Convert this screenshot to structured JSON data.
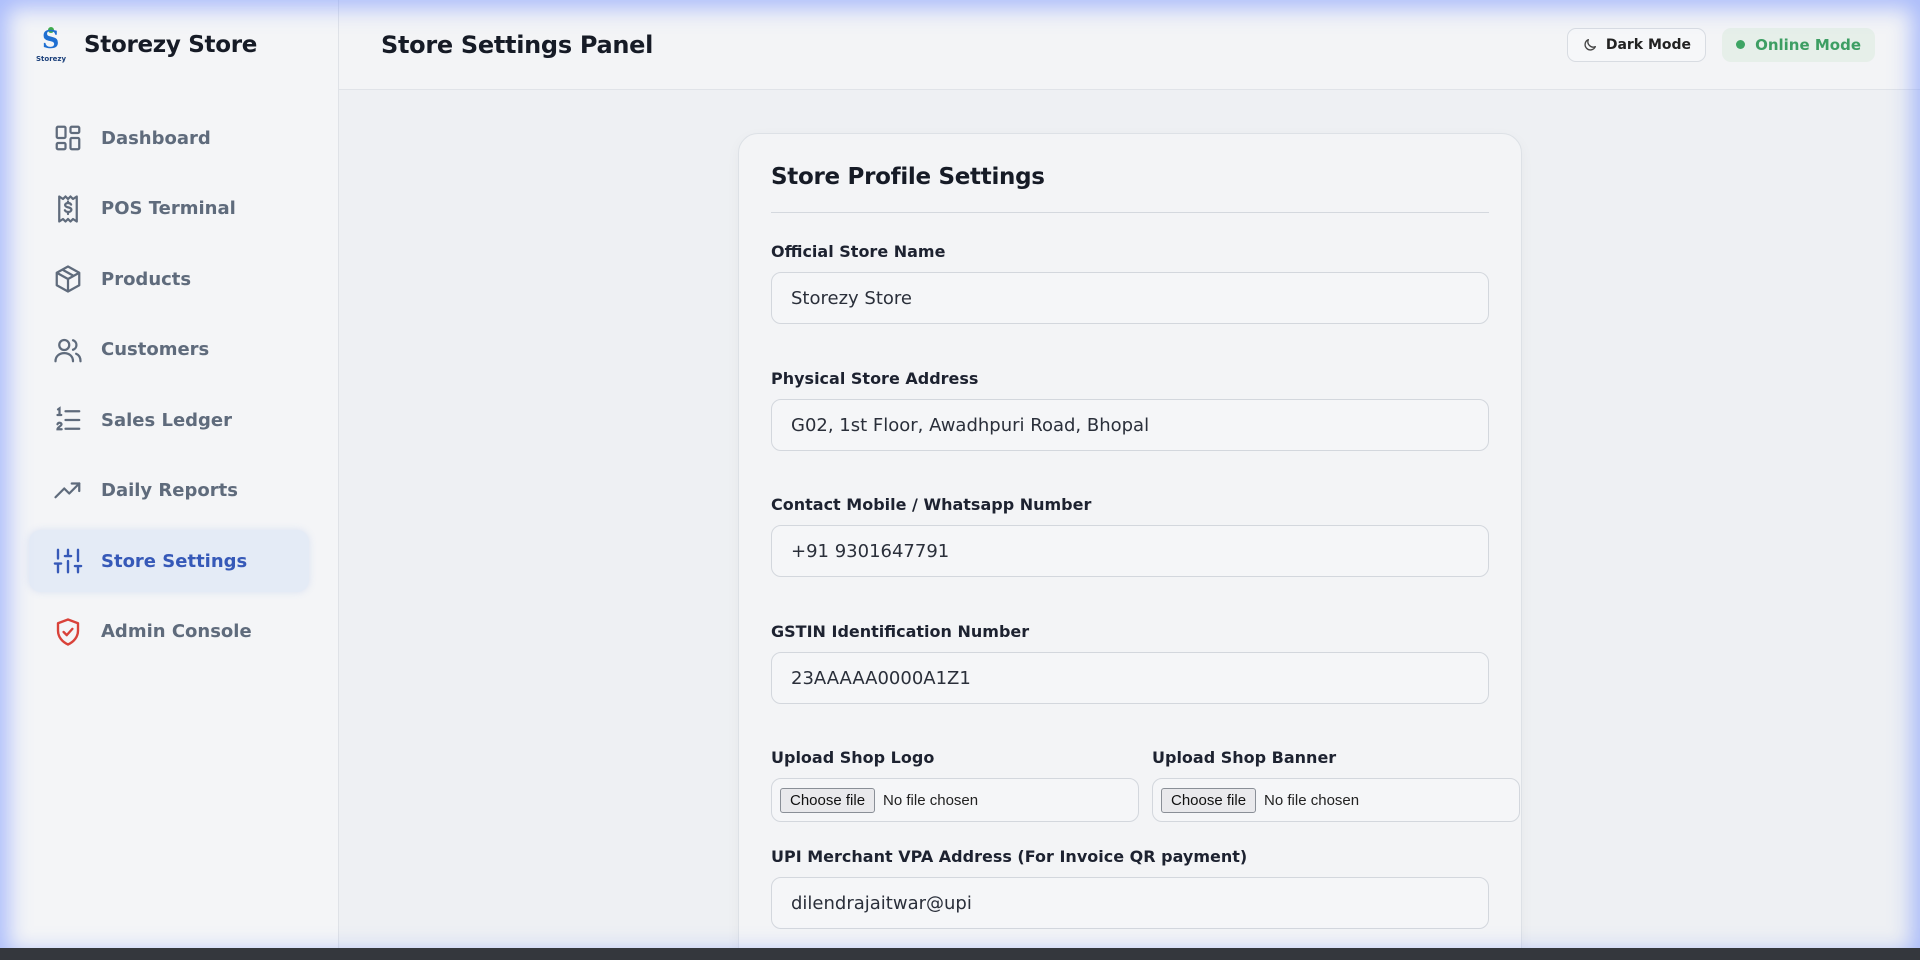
{
  "brand": {
    "name": "Storezy Store",
    "logo_caption": "Storezy",
    "logo_letter": "S"
  },
  "sidebar": {
    "items": [
      {
        "label": "Dashboard",
        "icon": "dashboard-icon",
        "active": false
      },
      {
        "label": "POS Terminal",
        "icon": "receipt-dollar-icon",
        "active": false
      },
      {
        "label": "Products",
        "icon": "box-icon",
        "active": false
      },
      {
        "label": "Customers",
        "icon": "users-icon",
        "active": false
      },
      {
        "label": "Sales Ledger",
        "icon": "numbered-list-icon",
        "active": false
      },
      {
        "label": "Daily Reports",
        "icon": "trending-up-icon",
        "active": false
      },
      {
        "label": "Store Settings",
        "icon": "sliders-icon",
        "active": true
      },
      {
        "label": "Admin Console",
        "icon": "shield-check-icon",
        "active": false
      }
    ]
  },
  "header": {
    "title": "Store Settings Panel",
    "dark_mode_label": "Dark Mode",
    "online_label": "Online Mode"
  },
  "card": {
    "title": "Store Profile Settings",
    "store_name": {
      "label": "Official Store Name",
      "value": "Storezy Store"
    },
    "address": {
      "label": "Physical Store Address",
      "value": "G02, 1st Floor, Awadhpuri Road, Bhopal"
    },
    "phone": {
      "label": "Contact Mobile / Whatsapp Number",
      "value": "+91 9301647791"
    },
    "gstin": {
      "label": "GSTIN Identification Number",
      "value": "23AAAAA0000A1Z1"
    },
    "logo_upload": {
      "label": "Upload Shop Logo",
      "button": "Choose file",
      "status": "No file chosen"
    },
    "banner_upload": {
      "label": "Upload Shop Banner",
      "button": "Choose file",
      "status": "No file chosen"
    },
    "upi": {
      "label": "UPI Merchant VPA Address (For Invoice QR payment)",
      "value": "dilendrajaitwar@upi"
    }
  },
  "colors": {
    "accent": "#3659b8",
    "online": "#3d9e63",
    "admin_icon": "#d9423a"
  }
}
